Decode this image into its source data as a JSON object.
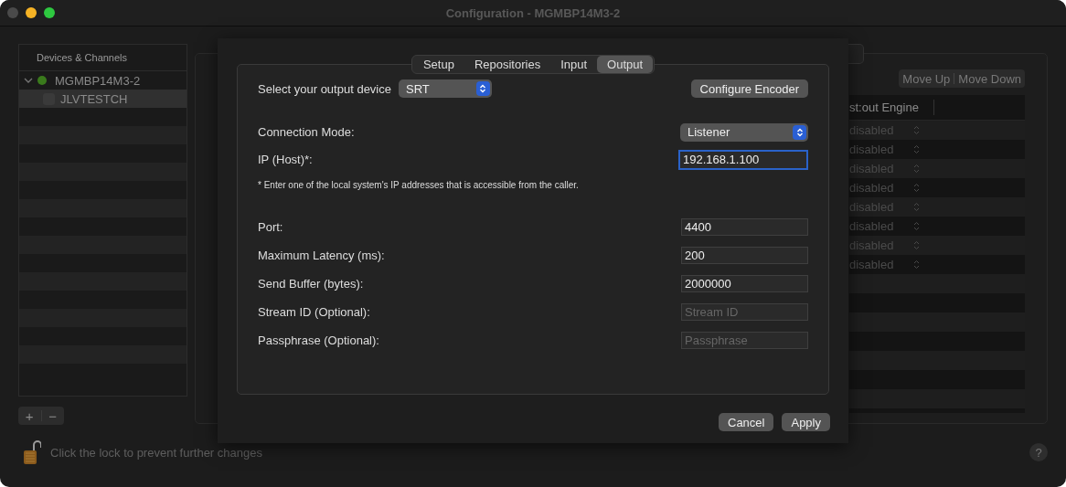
{
  "window": {
    "title": "Configuration - MGMBP14M3-2"
  },
  "sidebar": {
    "title": "Devices & Channels",
    "items": [
      {
        "label": "MGMBP14M3-2",
        "expanded": true,
        "selected": false,
        "children": [
          {
            "label": "JLVTESTCH",
            "checked": false,
            "selected": true
          }
        ]
      }
    ],
    "buttons": [
      "+",
      "−"
    ]
  },
  "panel": {
    "buttons": [
      "Move Up",
      "Move Down"
    ],
    "table": {
      "columns": [
        "st:out Engine"
      ],
      "rows": [
        "disabled",
        "disabled",
        "disabled",
        "disabled",
        "disabled",
        "disabled",
        "disabled",
        "disabled"
      ]
    }
  },
  "footer": {
    "lock_text": "Click the lock to prevent further changes",
    "help": "?"
  },
  "sheet": {
    "tabs": [
      {
        "label": "Setup",
        "selected": false
      },
      {
        "label": "Repositories",
        "selected": false
      },
      {
        "label": "Input",
        "selected": false
      },
      {
        "label": "Output",
        "selected": true
      }
    ],
    "device": {
      "label": "Select your output device",
      "value": "SRT"
    },
    "configure_button": "Configure Encoder",
    "fields": [
      {
        "kind": "select",
        "label": "Connection Mode:",
        "value": "Listener"
      },
      {
        "kind": "text",
        "label": "IP (Host)*:",
        "value": "192.168.1.100",
        "focused": true
      },
      {
        "kind": "note",
        "text": "* Enter one of the local system's IP addresses that is accessible from the caller."
      },
      {
        "kind": "text",
        "label": "Port:",
        "value": "4400",
        "focused": false
      },
      {
        "kind": "text",
        "label": "Maximum Latency (ms):",
        "value": "200",
        "focused": false
      },
      {
        "kind": "text",
        "label": "Send Buffer (bytes):",
        "value": "2000000",
        "focused": false
      },
      {
        "kind": "text",
        "label": "Stream ID (Optional):",
        "placeholder": "Stream ID",
        "focused": false
      },
      {
        "kind": "text",
        "label": "Passphrase (Optional):",
        "placeholder": "Passphrase",
        "focused": false
      }
    ],
    "buttons": [
      "Cancel",
      "Apply"
    ]
  }
}
